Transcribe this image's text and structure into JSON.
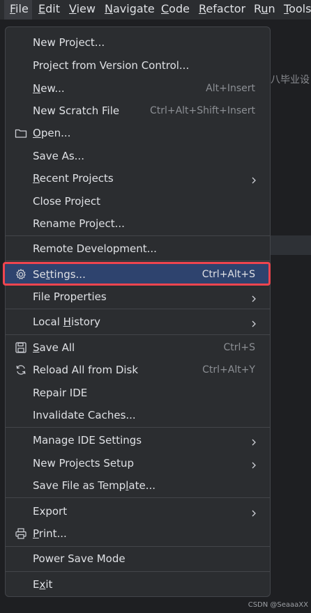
{
  "menubar": {
    "items": [
      {
        "label": "File",
        "mnemonic_index": 0
      },
      {
        "label": "Edit",
        "mnemonic_index": 0
      },
      {
        "label": "View",
        "mnemonic_index": 0
      },
      {
        "label": "Navigate",
        "mnemonic_index": 0
      },
      {
        "label": "Code",
        "mnemonic_index": 0
      },
      {
        "label": "Refactor",
        "mnemonic_index": 0
      },
      {
        "label": "Run",
        "mnemonic_index": 1
      },
      {
        "label": "Tools",
        "mnemonic_index": 0
      }
    ]
  },
  "background": {
    "partial_text": "八毕业设"
  },
  "file_menu": {
    "items": [
      {
        "label": "New Project...",
        "shortcut": "",
        "submenu": false,
        "icon": null
      },
      {
        "label": "Project from Version Control...",
        "shortcut": "",
        "submenu": false,
        "icon": null
      },
      {
        "label": "New...",
        "shortcut": "Alt+Insert",
        "submenu": false,
        "icon": null,
        "mnemonic": "N"
      },
      {
        "label": "New Scratch File",
        "shortcut": "Ctrl+Alt+Shift+Insert",
        "submenu": false,
        "icon": null
      },
      {
        "label": "Open...",
        "shortcut": "",
        "submenu": false,
        "icon": "folder-icon",
        "mnemonic": "O"
      },
      {
        "label": "Save As...",
        "shortcut": "",
        "submenu": false,
        "icon": null
      },
      {
        "label": "Recent Projects",
        "shortcut": "",
        "submenu": true,
        "icon": null,
        "mnemonic": "R"
      },
      {
        "label": "Close Project",
        "shortcut": "",
        "submenu": false,
        "icon": null
      },
      {
        "label": "Rename Project...",
        "shortcut": "",
        "submenu": false,
        "icon": null
      },
      {
        "label": "Remote Development...",
        "shortcut": "",
        "submenu": false,
        "icon": null
      },
      {
        "label": "Settings...",
        "shortcut": "Ctrl+Alt+S",
        "submenu": false,
        "icon": "gear-icon",
        "mnemonic": "t",
        "highlighted": true
      },
      {
        "label": "File Properties",
        "shortcut": "",
        "submenu": true,
        "icon": null
      },
      {
        "label": "Local History",
        "shortcut": "",
        "submenu": true,
        "icon": null,
        "mnemonic": "H"
      },
      {
        "label": "Save All",
        "shortcut": "Ctrl+S",
        "submenu": false,
        "icon": "save-icon",
        "mnemonic": "S"
      },
      {
        "label": "Reload All from Disk",
        "shortcut": "Ctrl+Alt+Y",
        "submenu": false,
        "icon": "reload-icon"
      },
      {
        "label": "Repair IDE",
        "shortcut": "",
        "submenu": false,
        "icon": null
      },
      {
        "label": "Invalidate Caches...",
        "shortcut": "",
        "submenu": false,
        "icon": null
      },
      {
        "label": "Manage IDE Settings",
        "shortcut": "",
        "submenu": true,
        "icon": null
      },
      {
        "label": "New Projects Setup",
        "shortcut": "",
        "submenu": true,
        "icon": null
      },
      {
        "label": "Save File as Template...",
        "shortcut": "",
        "submenu": false,
        "icon": null,
        "mnemonic": "l"
      },
      {
        "label": "Export",
        "shortcut": "",
        "submenu": true,
        "icon": null
      },
      {
        "label": "Print...",
        "shortcut": "",
        "submenu": false,
        "icon": "print-icon",
        "mnemonic": "P"
      },
      {
        "label": "Power Save Mode",
        "shortcut": "",
        "submenu": false,
        "icon": null
      },
      {
        "label": "Exit",
        "shortcut": "",
        "submenu": false,
        "icon": null,
        "mnemonic": "x"
      }
    ]
  },
  "watermark": "CSDN @SeaaaXX",
  "colors": {
    "menu_bg": "#2b2d30",
    "highlight_bg": "#2e436e",
    "highlight_border": "#f0454f",
    "text": "#dfe1e5",
    "shortcut_text": "#8c8f94"
  }
}
